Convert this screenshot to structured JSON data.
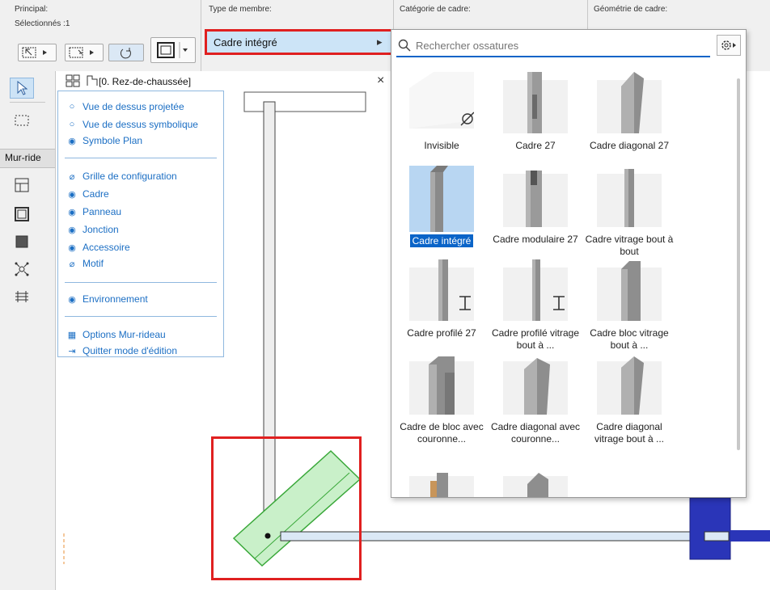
{
  "info_bar": {
    "principal_label": "Principal:",
    "selected_label": "Sélectionnés :1",
    "member_type_label": "Type de membre:",
    "frame_category_label": "Catégorie de cadre:",
    "frame_geometry_label": "Géométrie de cadre:"
  },
  "member_type": {
    "value": "Cadre intégré",
    "arrow": "▸"
  },
  "toolbox": {
    "current_tool_label": "Mur-ride"
  },
  "view_panel": {
    "story_label": "[0. Rez-de-chaussée]",
    "close_symbol": "×",
    "display_modes": [
      {
        "label": "Vue de dessus projetée",
        "selected": false
      },
      {
        "label": "Vue de dessus symbolique",
        "selected": false
      },
      {
        "label": "Symbole Plan",
        "selected": true
      }
    ],
    "visibility_items": [
      {
        "label": "Grille de configuration",
        "visible": false
      },
      {
        "label": "Cadre",
        "visible": true
      },
      {
        "label": "Panneau",
        "visible": true
      },
      {
        "label": "Jonction",
        "visible": true
      },
      {
        "label": "Accessoire",
        "visible": true
      },
      {
        "label": "Motif",
        "visible": false
      }
    ],
    "environment_label": "Environnement",
    "actions": [
      {
        "label": "Options Mur-rideau",
        "icon": "grid-icon"
      },
      {
        "label": "Quitter mode d'édition",
        "icon": "exit-icon"
      }
    ]
  },
  "library": {
    "search_placeholder": "Rechercher ossatures",
    "items": [
      {
        "label": "Invisible",
        "icon": "empty-set",
        "selected": false
      },
      {
        "label": "Cadre 27",
        "icon": "slot-profile",
        "selected": false
      },
      {
        "label": "Cadre diagonal 27",
        "icon": "diagonal-profile",
        "selected": false
      },
      {
        "label": "Cadre intégré",
        "icon": "integrated-profile",
        "selected": true
      },
      {
        "label": "Cadre modulaire 27",
        "icon": "modular-profile",
        "selected": false
      },
      {
        "label": "Cadre vitrage bout à bout",
        "icon": "butt-glazing-profile",
        "selected": false
      },
      {
        "label": "Cadre profilé 27",
        "icon": "i-beam-profile",
        "selected": false
      },
      {
        "label": "Cadre profilé vitrage bout à ...",
        "icon": "i-beam-profile",
        "selected": false
      },
      {
        "label": "Cadre bloc vitrage bout à ...",
        "icon": "block-profile",
        "selected": false
      },
      {
        "label": "Cadre de bloc avec couronne...",
        "icon": "capped-block-profile",
        "selected": false
      },
      {
        "label": "Cadre diagonal avec couronne...",
        "icon": "capped-diagonal-profile",
        "selected": false
      },
      {
        "label": "Cadre diagonal vitrage bout à ...",
        "icon": "diagonal-glazing-profile",
        "selected": false
      }
    ]
  },
  "colors": {
    "highlight_red": "#e02020",
    "link_blue": "#1c6fc4",
    "selection_blue": "#0a64c8",
    "frame_green": "#3aa83a",
    "wall_blue": "#2a35b8"
  }
}
